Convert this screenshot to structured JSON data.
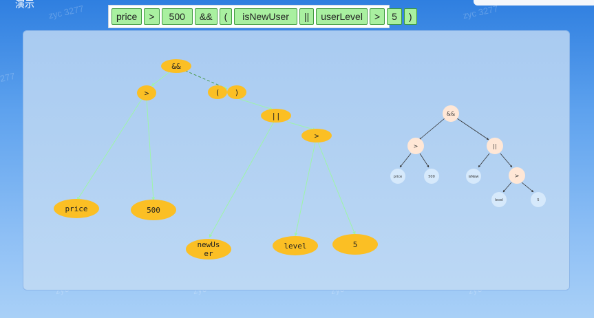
{
  "header": {
    "title": "演示"
  },
  "expression_tokens": [
    "price",
    ">",
    "500",
    "&&",
    "(",
    "isNewUser",
    "||",
    "userLevel",
    ">",
    "5",
    ")"
  ],
  "watermark_text": "zyc 3277",
  "colors": {
    "token_fill": "#a9f0a0",
    "node_fill": "#fbbf24",
    "edge_color": "#9ef5a8",
    "tree_node_fill": "#ffe7d6",
    "tree_leaf_fill": "#d6e9fb",
    "indicator_arrow": "#e01e1e"
  },
  "large_tree": {
    "nodes": {
      "and": "&&",
      "gt1": ">",
      "lparen": "(",
      "rparen": ")",
      "or": "||",
      "gt2": ">",
      "price": "price",
      "n500": "500",
      "newuser_line1": "newUs",
      "newuser_line2": "er",
      "level": "level",
      "n5": "5"
    }
  },
  "small_tree": {
    "nodes": {
      "and": "&&",
      "gt1": ">",
      "or": "||",
      "gt2": ">",
      "price": "price",
      "n500": "500",
      "isnew": "isNew",
      "level": "level",
      "n5": "5"
    }
  }
}
